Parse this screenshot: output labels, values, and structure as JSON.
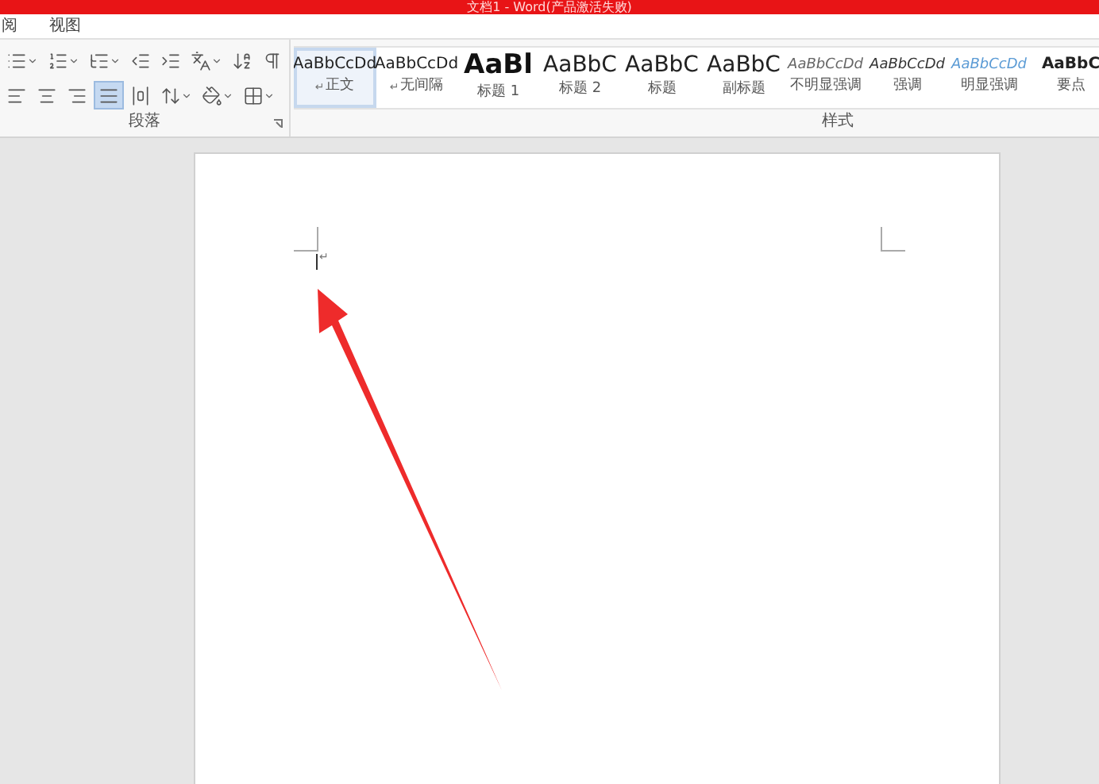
{
  "window": {
    "title": "文档1 - Word(产品激活失败)"
  },
  "menu_tabs": [
    {
      "label": "阅",
      "selected": false
    },
    {
      "label": "视图",
      "selected": false
    }
  ],
  "paragraph_group": {
    "label": "段落",
    "alignment_buttons": [
      {
        "selected": false
      },
      {
        "selected": false
      },
      {
        "selected": false
      },
      {
        "selected": true
      },
      {
        "selected": false
      }
    ]
  },
  "styles_group": {
    "label": "样式",
    "styles": [
      {
        "kind": "body",
        "sample": "AaBbCcDd",
        "mark": "↵",
        "label": "正文",
        "selected": true
      },
      {
        "kind": "no_spacing",
        "sample": "AaBbCcDd",
        "mark": "↵",
        "label": "无间隔",
        "selected": false
      },
      {
        "kind": "heading1",
        "sample": "AaBl",
        "label": "标题 1",
        "selected": false
      },
      {
        "kind": "heading2",
        "sample": "AaBbC",
        "label": "标题 2",
        "selected": false
      },
      {
        "kind": "title",
        "sample": "AaBbC",
        "label": "标题",
        "selected": false
      },
      {
        "kind": "subtitle",
        "sample": "AaBbC",
        "label": "副标题",
        "selected": false
      },
      {
        "kind": "subtle_emphasis",
        "sample": "AaBbCcDd",
        "label": "不明显强调",
        "selected": false
      },
      {
        "kind": "emphasis",
        "sample": "AaBbCcDd",
        "label": "强调",
        "selected": false
      },
      {
        "kind": "intense_emphasis",
        "sample": "AaBbCcDd",
        "label": "明显强调",
        "selected": false
      },
      {
        "kind": "strong",
        "sample": "AaBbC",
        "label": "要点",
        "selected": false
      }
    ]
  },
  "document": {
    "paragraph_mark": "↵"
  }
}
